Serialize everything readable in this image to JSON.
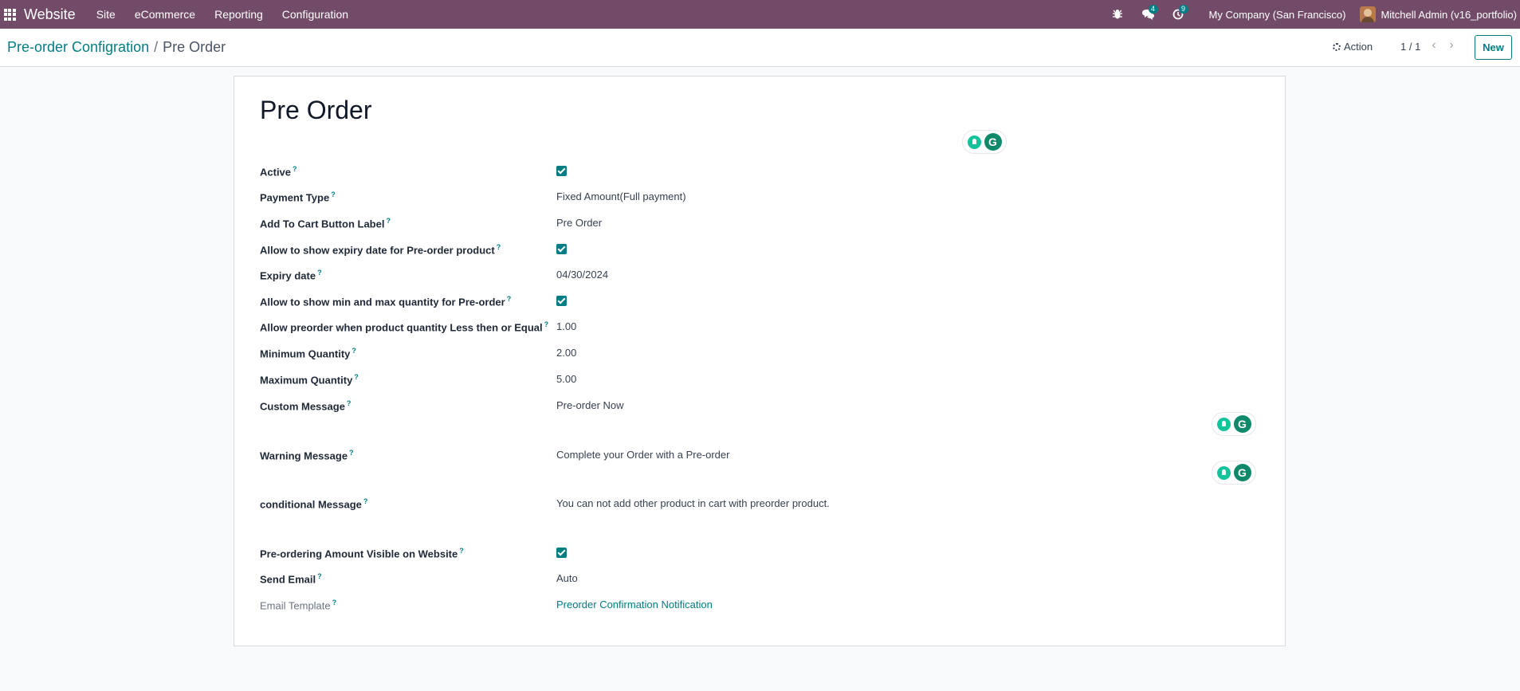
{
  "navbar": {
    "brand": "Website",
    "menu": [
      "Site",
      "eCommerce",
      "Reporting",
      "Configuration"
    ],
    "messages_count": "4",
    "activities_count": "9",
    "company": "My Company (San Francisco)",
    "user": "Mitchell Admin (v16_portfolio)"
  },
  "control_panel": {
    "breadcrumb_parent": "Pre-order Configration",
    "breadcrumb_separator": "/",
    "breadcrumb_current": "Pre Order",
    "action_label": "Action",
    "pager": "1 / 1",
    "new_label": "New"
  },
  "form": {
    "title": "Pre Order",
    "help_mark": "?",
    "fields": {
      "active": {
        "label": "Active",
        "checked": true
      },
      "payment_type": {
        "label": "Payment Type",
        "value": "Fixed Amount(Full payment)"
      },
      "add_to_cart_label": {
        "label": "Add To Cart Button Label",
        "value": "Pre Order"
      },
      "show_expiry": {
        "label": "Allow to show expiry date for Pre-order product",
        "checked": true
      },
      "expiry_date": {
        "label": "Expiry date",
        "value": "04/30/2024"
      },
      "show_min_max": {
        "label": "Allow to show min and max quantity for Pre-order",
        "checked": true
      },
      "preorder_threshold": {
        "label": "Allow preorder when product quantity Less then or Equal",
        "value": "1.00"
      },
      "min_qty": {
        "label": "Minimum Quantity",
        "value": "2.00"
      },
      "max_qty": {
        "label": "Maximum Quantity",
        "value": "5.00"
      },
      "custom_message": {
        "label": "Custom Message",
        "value": "Pre-order Now"
      },
      "warning_message": {
        "label": "Warning Message",
        "value": "Complete your Order with a Pre-order"
      },
      "conditional_message": {
        "label": "conditional Message",
        "value": "You can not add other product in cart with preorder product."
      },
      "amount_visible": {
        "label": "Pre-ordering Amount Visible on Website",
        "checked": true
      },
      "send_email": {
        "label": "Send Email",
        "value": "Auto"
      },
      "email_template": {
        "label": "Email Template",
        "value": "Preorder Confirmation Notification"
      }
    }
  },
  "icons": {
    "apps": "grid-icon",
    "debug": "bug-icon",
    "messages": "chat-icon",
    "activities": "clock-icon",
    "action": "gear-icon",
    "prev": "chevron-left-icon",
    "next": "chevron-right-icon",
    "assistant": "grammarly-icon"
  },
  "colors": {
    "navbar": "#714b67",
    "accent": "#017e84"
  }
}
